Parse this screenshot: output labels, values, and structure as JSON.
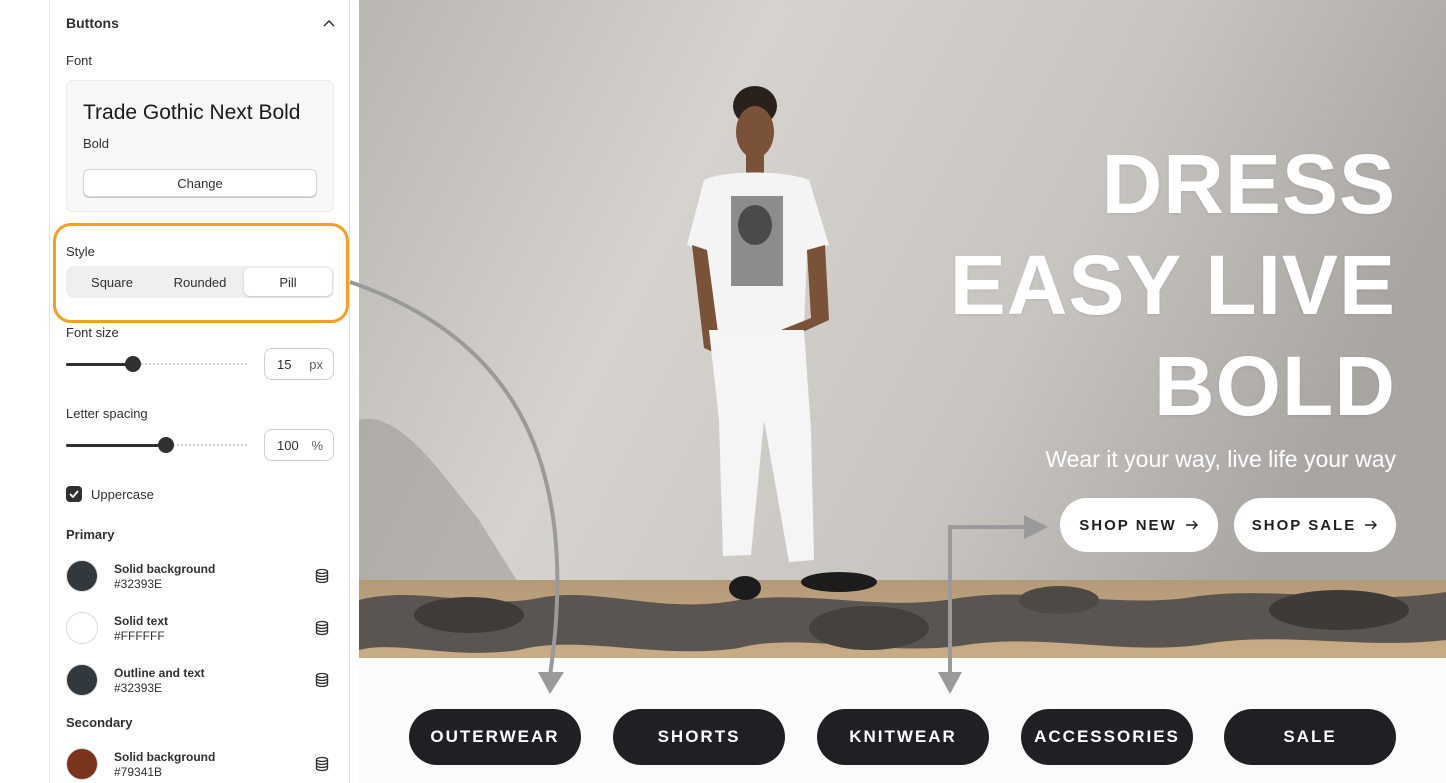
{
  "panel": {
    "section_title": "Buttons",
    "font_label": "Font",
    "font_name": "Trade Gothic Next Bold",
    "font_weight": "Bold",
    "change_label": "Change",
    "style_label": "Style",
    "style_options": [
      "Square",
      "Rounded",
      "Pill"
    ],
    "style_selected": "Pill",
    "font_size": {
      "label": "Font size",
      "value": "15",
      "unit": "px",
      "fill_fraction": 0.37
    },
    "letter_spacing": {
      "label": "Letter spacing",
      "value": "100",
      "unit": "%",
      "fill_fraction": 0.55
    },
    "uppercase": {
      "label": "Uppercase",
      "checked": true
    },
    "primary": {
      "title": "Primary",
      "colors": [
        {
          "name": "Solid background",
          "hex": "#32393E"
        },
        {
          "name": "Solid text",
          "hex": "#FFFFFF"
        },
        {
          "name": "Outline and text",
          "hex": "#32393E"
        }
      ]
    },
    "secondary": {
      "title": "Secondary",
      "colors": [
        {
          "name": "Solid background",
          "hex": "#79341B"
        }
      ]
    }
  },
  "preview": {
    "hero_lines": [
      "DRESS",
      "EASY LIVE",
      "BOLD"
    ],
    "hero_subtitle": "Wear it your way, live life your way",
    "hero_buttons": [
      {
        "label": "SHOP NEW",
        "icon": "arrow-right-icon"
      },
      {
        "label": "SHOP SALE",
        "icon": "arrow-right-icon"
      }
    ],
    "pill_buttons": [
      "OUTERWEAR",
      "SHORTS",
      "KNITWEAR",
      "ACCESSORIES",
      "SALE"
    ]
  },
  "colors": {
    "accent_highlight": "#F5A020",
    "button_dark": "#1E2024",
    "annotation_arrow": "#9A9A9A"
  }
}
